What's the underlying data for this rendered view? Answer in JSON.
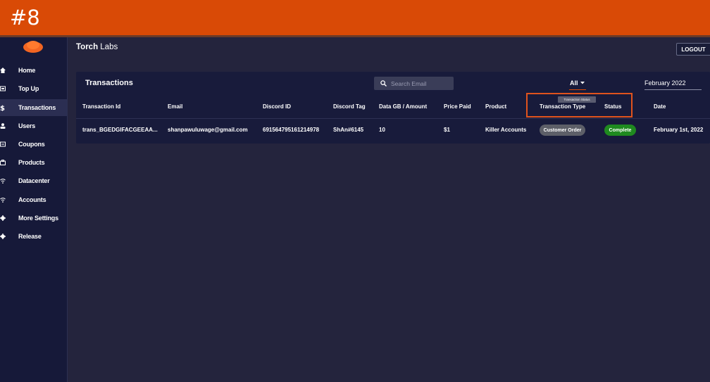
{
  "banner": {
    "title": "#8",
    "color": "#d94a06"
  },
  "brand": {
    "bold": "Torch",
    "rest": " Labs"
  },
  "header": {
    "logout_label": "LOGOUT"
  },
  "sidebar": {
    "items": [
      {
        "label": "Home",
        "icon": "home-icon"
      },
      {
        "label": "Top Up",
        "icon": "top-up-icon"
      },
      {
        "label": "Transactions",
        "icon": "dollar-icon",
        "active": true
      },
      {
        "label": "Users",
        "icon": "user-icon"
      },
      {
        "label": "Coupons",
        "icon": "coupon-icon"
      },
      {
        "label": "Products",
        "icon": "products-icon"
      },
      {
        "label": "Datacenter",
        "icon": "wifi-icon"
      },
      {
        "label": "Accounts",
        "icon": "wifi-icon"
      },
      {
        "label": "More Settings",
        "icon": "gear-icon"
      },
      {
        "label": "Release",
        "icon": "gear-icon"
      }
    ]
  },
  "transactions": {
    "title": "Transactions",
    "search_placeholder": "Search Email",
    "filter_label": "All",
    "date_filter": "February 2022",
    "tooltip": "Transaction Status",
    "columns": [
      "Transaction Id",
      "Email",
      "Discord ID",
      "Discord Tag",
      "Data GB / Amount",
      "Price Paid",
      "Product",
      "Transaction Type",
      "Status",
      "Date"
    ],
    "rows": [
      {
        "transaction_id": "trans_BGEDGIFACGEEAA...",
        "email": "shanpawuluwage@gmail.com",
        "discord_id": "691564795161214978",
        "discord_tag": "ShAn#6145",
        "amount": "10",
        "price": "$1",
        "product": "Killer Accounts",
        "type": "Customer Order",
        "status": "Complete",
        "date": "February 1st, 2022"
      }
    ]
  },
  "colors": {
    "accent": "#d94a06",
    "status_complete": "#1f8a1f",
    "type_badge": "#5d5f68"
  }
}
